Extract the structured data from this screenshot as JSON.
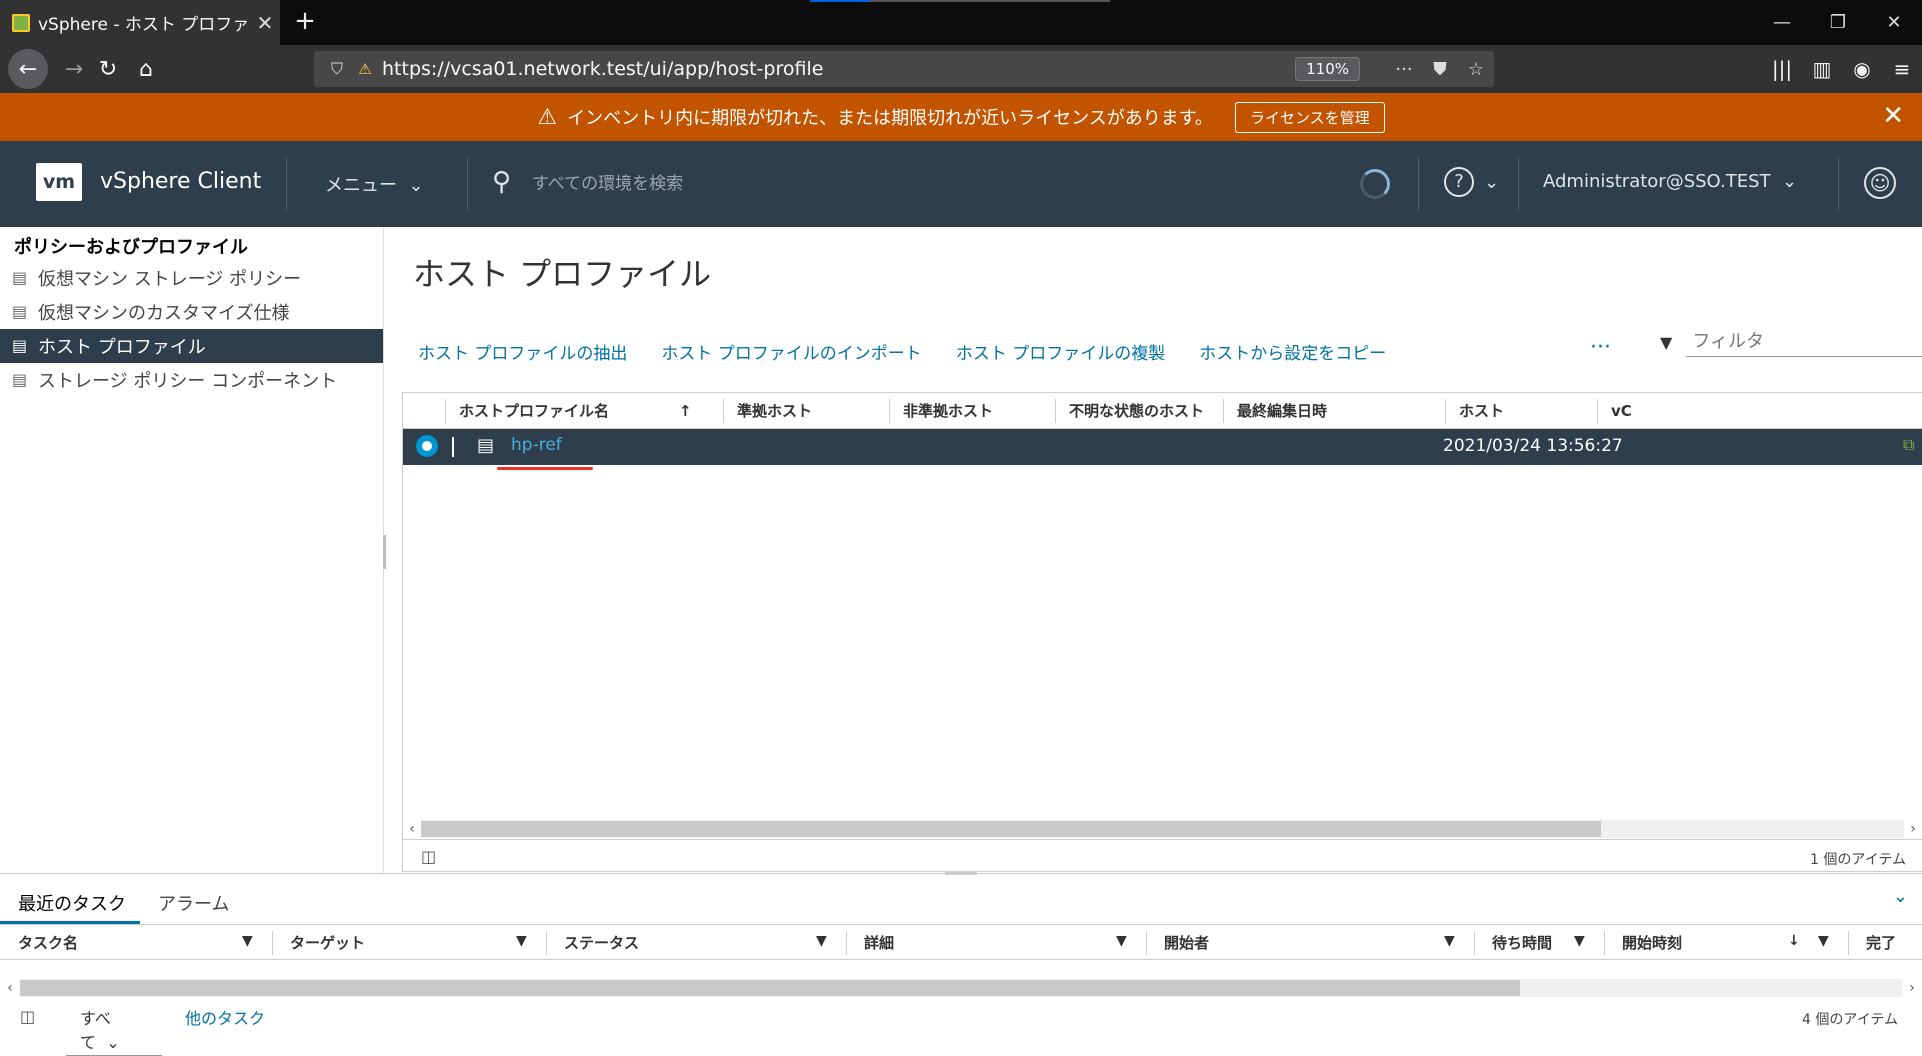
{
  "browser": {
    "tab_title": "vSphere - ホスト プロファイル",
    "tab_close": "✕",
    "new_tab": "+",
    "url": "https://vcsa01.network.test/ui/app/host-profile",
    "zoom": "110%",
    "window_controls": [
      "—",
      "❐",
      "✕"
    ],
    "icons": [
      "back-icon",
      "forward-icon",
      "reload-icon",
      "home-icon",
      "library-icon",
      "sidebar-icon",
      "account-icon",
      "menu-icon"
    ]
  },
  "banner": {
    "message": "インベントリ内に期限が切れた、または期限切れが近いライセンスがあります。",
    "button": "ライセンスを管理",
    "color": "#c25400"
  },
  "header": {
    "logo": "vm",
    "app_name": "vSphere Client",
    "menu": "メニュー",
    "search_placeholder": "すべての環境を検索",
    "user": "Administrator@SSO.TEST",
    "color": "#2f3e4c"
  },
  "sidebar": {
    "title": "ポリシーおよびプロファイル",
    "items": [
      {
        "label": "仮想マシン ストレージ ポリシー"
      },
      {
        "label": "仮想マシンのカスタマイズ仕様"
      },
      {
        "label": "ホスト プロファイル"
      },
      {
        "label": "ストレージ ポリシー コンポーネント"
      }
    ],
    "active_index": 2
  },
  "main": {
    "title": "ホスト プロファイル",
    "actions": [
      "ホスト プロファイルの抽出",
      "ホスト プロファイルのインポート",
      "ホスト プロファイルの複製",
      "ホストから設定をコピー"
    ],
    "more": "···",
    "filter_placeholder": "フィルタ",
    "grid": {
      "columns": [
        "ホストプロファイル名",
        "準拠ホスト",
        "非準拠ホスト",
        "不明な状態のホスト",
        "最終編集日時",
        "ホスト",
        "vC"
      ],
      "sort_indicator": "↑",
      "rows": [
        {
          "name": "hp-ref",
          "compliant": "",
          "noncompliant": "",
          "unknown": "",
          "last_edited": "2021/03/24 13:56:27",
          "hosts": "",
          "selected": true
        }
      ],
      "count": "1 個のアイテム"
    }
  },
  "tasks": {
    "tabs": [
      "最近のタスク",
      "アラーム"
    ],
    "columns": [
      "タスク名",
      "ターゲット",
      "ステータス",
      "詳細",
      "開始者",
      "待ち時間",
      "開始時刻",
      "完了"
    ],
    "filter_all": "すべて",
    "other_tasks": "他のタスク",
    "count": "4 個のアイテム"
  }
}
